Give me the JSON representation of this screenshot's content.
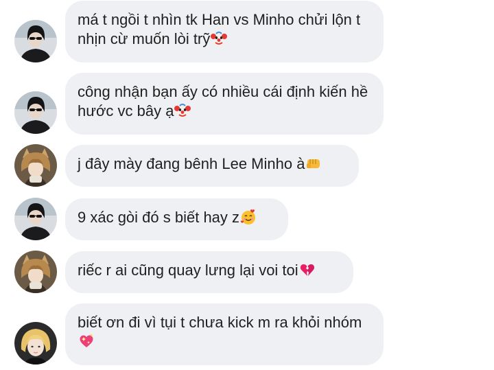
{
  "messages": [
    {
      "text": "má t ngồi t nhìn tk Han vs Minho chửi lộn t nhịn cừ muốn lòi trỹ",
      "emoji": "clown-face-icon",
      "avatar": "avatar-sunglasses-icon"
    },
    {
      "text": "công nhận bạn ấy có nhiều cái định kiến hề hước vc bây ạ",
      "emoji": "clown-face-icon",
      "avatar": "avatar-sunglasses-icon"
    },
    {
      "text": "j đây mày đang bênh Lee Minho à",
      "emoji": "oncoming-fist-icon",
      "avatar": "avatar-cat-ears-icon"
    },
    {
      "text": "9 xác gòi đó s biết hay z",
      "emoji": "smiling-face-with-hearts-icon",
      "avatar": "avatar-sunglasses-icon"
    },
    {
      "text": "riếc r ai cũng quay lưng lại voi toi",
      "emoji": "broken-heart-icon",
      "avatar": "avatar-cat-ears-icon"
    },
    {
      "text": "biết ơn đi vì tụi t chưa kick m ra khỏi nhóm",
      "emoji": "sparkling-heart-icon",
      "avatar": "avatar-blonde-icon"
    }
  ],
  "colors": {
    "bubble": "#eef0f3",
    "text": "#1f1f1f",
    "background": "#ffffff"
  }
}
